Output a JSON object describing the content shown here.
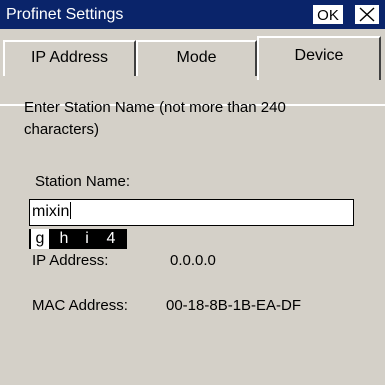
{
  "window": {
    "title": "Profinet Settings",
    "ok_label": "OK",
    "close_icon": "close-icon"
  },
  "tabs": [
    {
      "label": "IP Address",
      "selected": false
    },
    {
      "label": "Mode",
      "selected": false
    },
    {
      "label": "Device",
      "selected": true
    }
  ],
  "device": {
    "instruction": "Enter Station Name (not more than 240 characters)",
    "station_name_label": "Station Name:",
    "station_name_value": "mixin",
    "ip_address_label": "IP Address:",
    "ip_address_value": "0.0.0.0",
    "mac_address_label": "MAC Address:",
    "mac_address_value": "00-18-8B-1B-EA-DF"
  },
  "input_method": {
    "candidates": [
      "g",
      "h",
      "i",
      "4"
    ],
    "selected_index": 0
  },
  "colors": {
    "titlebar": "#0a246a",
    "window_bg": "#d4d0c8"
  }
}
